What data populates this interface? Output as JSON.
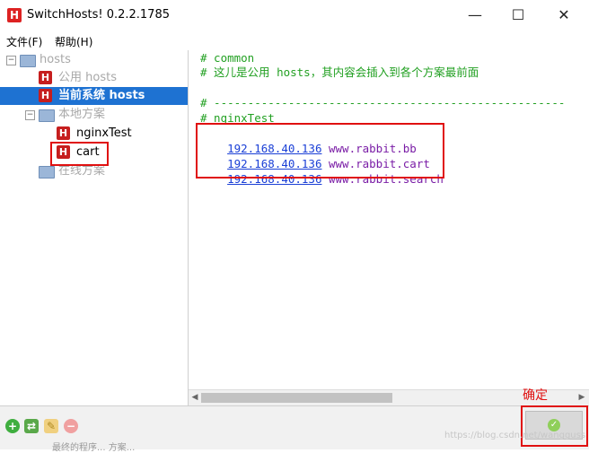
{
  "window": {
    "title": "SwitchHosts! 0.2.2.1785",
    "app_icon_letter": "H",
    "minimize": "—",
    "maximize": "☐",
    "close": "✕"
  },
  "menu": {
    "file": "文件(F)",
    "help": "帮助(H)"
  },
  "sidebar": {
    "root_label": "hosts",
    "public_label": "公用 hosts",
    "current_label": "当前系统 hosts",
    "local_label": "本地方案",
    "local_items": [
      "nginxTest",
      "cart"
    ],
    "online_label": "在线方案"
  },
  "editor": {
    "lines": [
      {
        "kind": "comment",
        "text": "# common"
      },
      {
        "kind": "comment",
        "text": "# 这儿是公用 hosts，其内容会插入到各个方案最前面"
      },
      {
        "kind": "blank",
        "text": ""
      },
      {
        "kind": "comment",
        "text": "# ----------------------------------------------------"
      },
      {
        "kind": "comment",
        "text": "# nginxTest"
      }
    ],
    "entries": [
      {
        "ip": "192.168.40.136",
        "host": "www.rabbit.bb"
      },
      {
        "ip": "192.168.40.136",
        "host": "www.rabbit.cart"
      },
      {
        "ip": "192.168.40.136",
        "host": "www.rabbit.search"
      }
    ]
  },
  "bottom": {
    "confirm_annotation": "确定",
    "watermark": "https://blog.csdn.net/wangguss",
    "background_text": "最终的程序... 方案..."
  },
  "colors": {
    "selected_bg": "#1e72d2",
    "comment": "#22a022",
    "ip": "#1a3fd6",
    "host": "#7a1da6",
    "annotation_red": "#e01010",
    "h_icon": "#c61e1e"
  },
  "icons": {
    "toolbar": [
      "add-icon",
      "refresh-icon",
      "edit-icon",
      "delete-icon"
    ],
    "confirm": "check-icon"
  }
}
